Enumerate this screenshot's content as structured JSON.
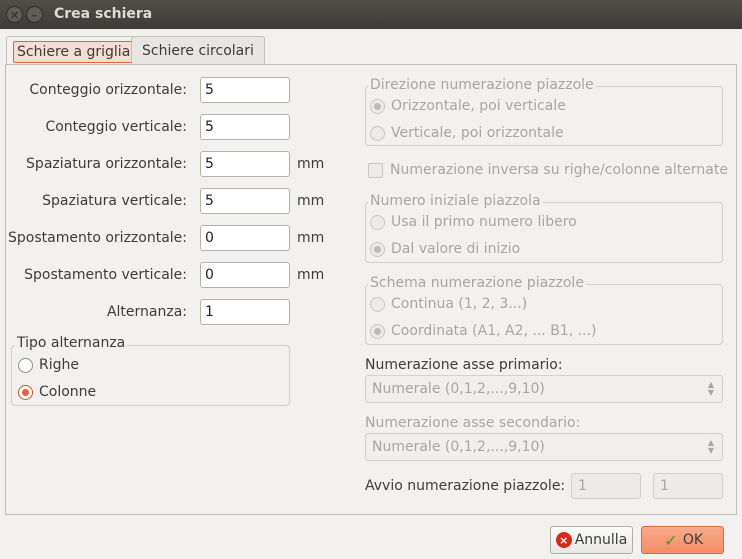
{
  "window": {
    "title": "Crea schiera",
    "close_glyph": "×",
    "minimize_glyph": "–"
  },
  "tabs": [
    {
      "label": "Schiere a griglia",
      "active": true
    },
    {
      "label": "Schiere circolari",
      "active": false
    }
  ],
  "grid": {
    "fields": [
      {
        "label": "Conteggio orizzontale:",
        "value": "5",
        "unit": ""
      },
      {
        "label": "Conteggio verticale:",
        "value": "5",
        "unit": ""
      },
      {
        "label": "Spaziatura orizzontale:",
        "value": "5",
        "unit": "mm"
      },
      {
        "label": "Spaziatura verticale:",
        "value": "5",
        "unit": "mm"
      },
      {
        "label": "Spostamento orizzontale:",
        "value": "0",
        "unit": "mm"
      },
      {
        "label": "Spostamento verticale:",
        "value": "0",
        "unit": "mm"
      },
      {
        "label": "Alternanza:",
        "value": "1",
        "unit": ""
      }
    ],
    "stagger_type": {
      "title": "Tipo alternanza",
      "options": [
        {
          "label": "Righe",
          "checked": false
        },
        {
          "label": "Colonne",
          "checked": true
        }
      ]
    }
  },
  "numbering": {
    "direction": {
      "title": "Direzione numerazione piazzole",
      "options": [
        {
          "label": "Orizzontale, poi verticale",
          "checked": true
        },
        {
          "label": "Verticale, poi orizzontale",
          "checked": false
        }
      ]
    },
    "reverse_checkbox": {
      "label": "Numerazione inversa su righe/colonne alternate",
      "checked": false
    },
    "start": {
      "title": "Numero iniziale piazzola",
      "options": [
        {
          "label": "Usa il primo numero libero",
          "checked": false
        },
        {
          "label": "Dal valore di inizio",
          "checked": true
        }
      ]
    },
    "scheme": {
      "title": "Schema numerazione piazzole",
      "options": [
        {
          "label": "Continua (1, 2, 3...)",
          "checked": false
        },
        {
          "label": "Coordinata (A1, A2, ... B1, ...)",
          "checked": true
        }
      ]
    },
    "primary_axis": {
      "label": "Numerazione asse primario:",
      "value": "Numerale (0,1,2,...,9,10)"
    },
    "secondary_axis": {
      "label": "Numerazione asse secondario:",
      "value": "Numerale (0,1,2,...,9,10)"
    },
    "pad_start": {
      "label": "Avvio numerazione piazzole:",
      "value1": "1",
      "value2": "1"
    }
  },
  "buttons": {
    "cancel": {
      "label": "Annulla",
      "icon_glyph": "×"
    },
    "ok": {
      "label": "OK",
      "icon_glyph": "✓"
    }
  },
  "colors": {
    "accent": "#e8633b",
    "titlebar": "#3c3b37",
    "background": "#f2f1f0"
  }
}
